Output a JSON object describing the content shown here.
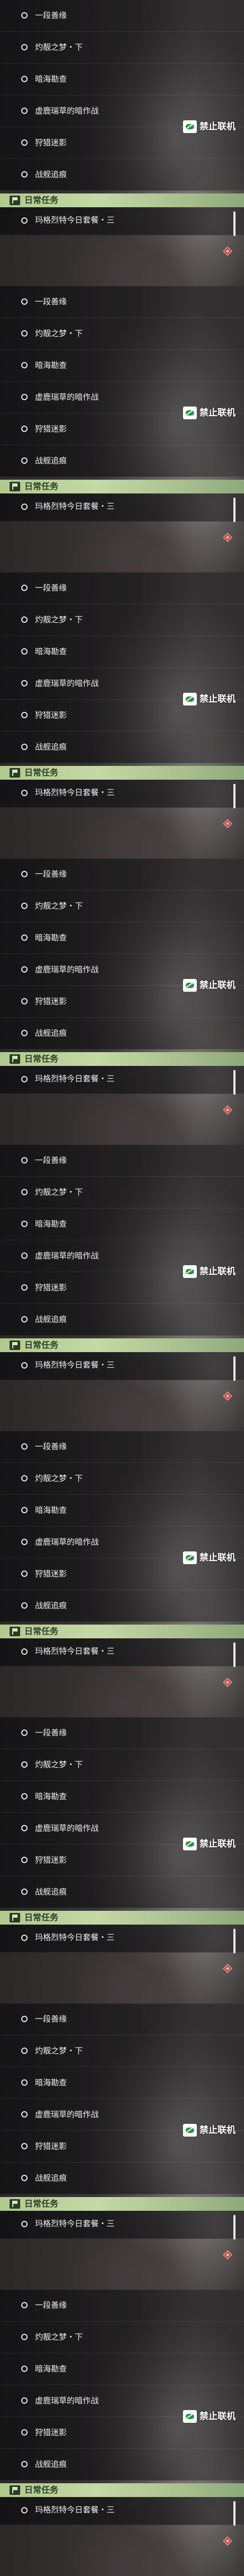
{
  "tasks": [
    "一段善缘",
    "灼靓之梦・下",
    "暗海勘查",
    "虚鹿瑞草的暗作战",
    "狩猎迷影",
    "战舰追痕"
  ],
  "multiplayer_badge": {
    "icon": "multiplayer-disabled-icon",
    "label": "禁止联机"
  },
  "daily_section": {
    "icon": "flag-icon",
    "title": "日常任务",
    "task": "玛格烈特今日套餐・三",
    "marker_icon": "quest-marker-diamond-icon"
  },
  "colors": {
    "daily_header": "#c4d9a5",
    "badge_green": "#2f8f45",
    "quest_marker": "#c5463e"
  }
}
